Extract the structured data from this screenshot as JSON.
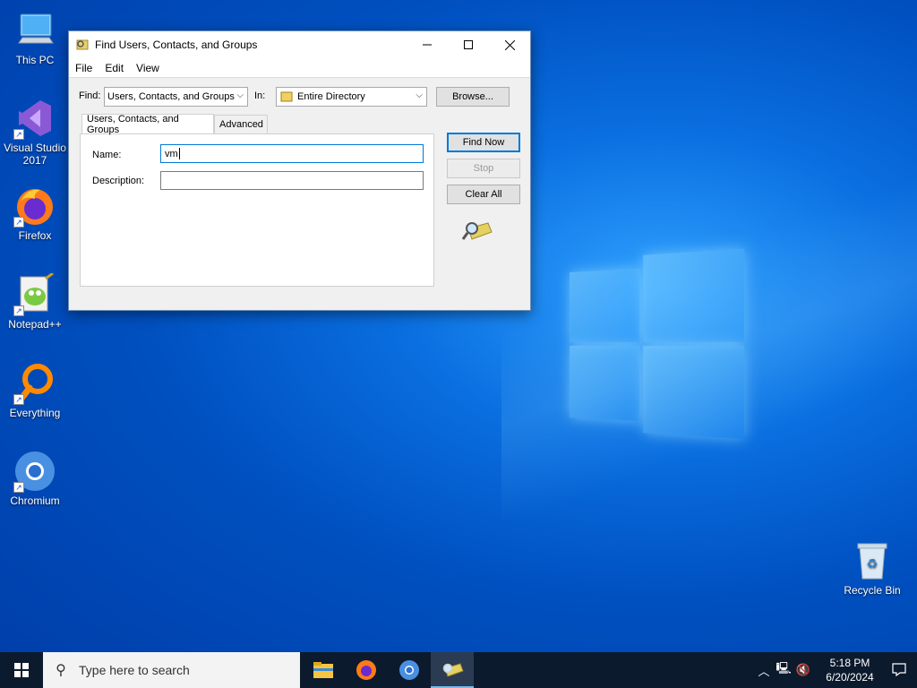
{
  "desktop": {
    "icons": [
      {
        "label": "This PC"
      },
      {
        "label": "Visual Studio\n2017"
      },
      {
        "label": "Firefox"
      },
      {
        "label": "Notepad++"
      },
      {
        "label": "Everything"
      },
      {
        "label": "Chromium"
      },
      {
        "label": "Recycle Bin"
      }
    ]
  },
  "dialog": {
    "title": "Find Users, Contacts, and Groups",
    "menu": [
      "File",
      "Edit",
      "View"
    ],
    "find_label": "Find:",
    "find_value": "Users, Contacts, and Groups",
    "in_label": "In:",
    "in_value": "Entire Directory",
    "browse_label": "Browse...",
    "tabs": [
      "Users, Contacts, and Groups",
      "Advanced"
    ],
    "name_label": "Name:",
    "name_value": "vm",
    "description_label": "Description:",
    "description_value": "",
    "find_now_label": "Find Now",
    "stop_label": "Stop",
    "clear_all_label": "Clear All"
  },
  "taskbar": {
    "search_placeholder": "Type here to search",
    "time": "5:18 PM",
    "date": "6/20/2024"
  },
  "colors": {
    "accent": "#0078d7",
    "taskbar": "#0c1a2e"
  }
}
